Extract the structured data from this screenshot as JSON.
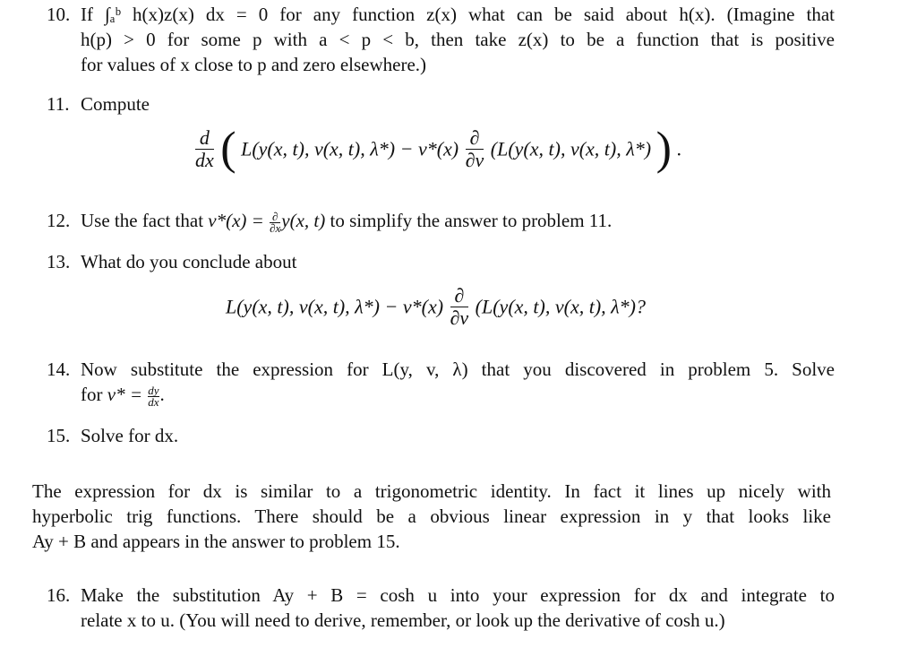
{
  "items": [
    {
      "number": "10.",
      "lines": [
        "If ∫ₐᵇ h(x)z(x) dx = 0 for any function z(x) what can be said about h(x). (Imagine that",
        "h(p) > 0 for some p with a < p < b, then take z(x) to be a function that is positive",
        "for values of x close to p and zero elsewhere.)"
      ]
    },
    {
      "number": "11.",
      "lines": [
        "Compute"
      ],
      "display": {
        "frac_num": "d",
        "frac_den": "dx",
        "left_paren": "(",
        "right_paren": ")",
        "expr1": "L(y(x, t), v(x, t), λ*) − v*(x)",
        "pfrac_num": "∂",
        "pfrac_den": "∂v",
        "expr2": "(L(y(x, t), v(x, t), λ*)",
        "end": "."
      }
    },
    {
      "number": "12.",
      "lines": [
        "Use the fact that v*(x) = ∂/∂x y(x, t) to simplify the answer to problem 11."
      ],
      "parts": {
        "pre": "Use the fact that ",
        "lhs": "v*(x) = ",
        "pnum": "∂",
        "pden": "∂x",
        "rhs": "y(x, t)",
        "post": " to simplify the answer to problem 11."
      }
    },
    {
      "number": "13.",
      "lines": [
        "What do you conclude about"
      ],
      "display": {
        "expr1": "L(y(x, t), v(x, t), λ*) − v*(x)",
        "pfrac_num": "∂",
        "pfrac_den": "∂v",
        "expr2": "(L(y(x, t), v(x, t), λ*)?"
      }
    },
    {
      "number": "14.",
      "lines": [
        "Now substitute the expression for L(y, v, λ) that you discovered in problem 5. Solve",
        "for v* = dy/dx."
      ],
      "parts": {
        "pre": "for ",
        "lhs": "v* = ",
        "fnum": "dy",
        "fden": "dx",
        "post": "."
      }
    },
    {
      "number": "15.",
      "lines": [
        "Solve for dx."
      ]
    }
  ],
  "paragraph": [
    "The expression for dx is similar to a trigonometric identity. In fact it lines up nicely with",
    "hyperbolic trig functions. There should be a obvious linear expression in y that looks like",
    "Ay + B and appears in the answer to problem 15."
  ],
  "item16": {
    "number": "16.",
    "lines": [
      "Make the substitution Ay + B = cosh u into your expression for dx and integrate to",
      "relate x to u. (You will need to derive, remember, or look up the derivative of cosh u.)"
    ]
  }
}
